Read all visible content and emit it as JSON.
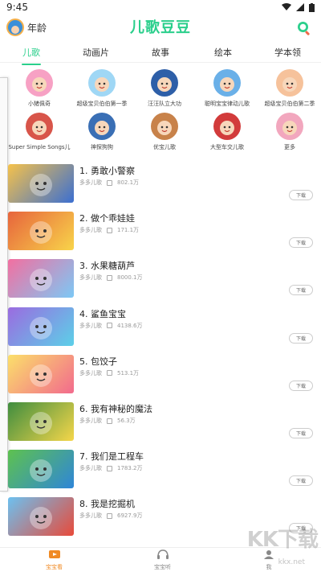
{
  "status_bar": {
    "time": "9:45"
  },
  "header": {
    "age_label": "年龄",
    "brand_title": "儿歌豆豆"
  },
  "tabs": [
    {
      "label": "儿歌",
      "active": true
    },
    {
      "label": "动画片",
      "active": false
    },
    {
      "label": "故事",
      "active": false
    },
    {
      "label": "绘本",
      "active": false
    },
    {
      "label": "学本领",
      "active": false
    }
  ],
  "categories": [
    {
      "label": "小猪佩奇",
      "icon": "peppa-pig-avatar",
      "color": "#f7a1c4"
    },
    {
      "label": "超级宝贝伯伯第一季",
      "icon": "baby-avatar",
      "color": "#9fd7f5"
    },
    {
      "label": "汪汪队立大功",
      "icon": "paw-patrol-avatar",
      "color": "#2e5fa8"
    },
    {
      "label": "聪明宝宝律动儿歌",
      "icon": "baby-boy-avatar",
      "color": "#6ab0e8"
    },
    {
      "label": "超级宝贝伯伯第二季",
      "icon": "baby-girl-avatar",
      "color": "#f6c29b"
    },
    {
      "label": "Super Simple Songs儿",
      "icon": "kid-red-shirt-avatar",
      "color": "#d8554a"
    },
    {
      "label": "神探狗狗",
      "icon": "detective-avatar",
      "color": "#3a6fb5"
    },
    {
      "label": "优宝儿歌",
      "icon": "cat-avatar",
      "color": "#c8824a"
    },
    {
      "label": "大型车交儿歌",
      "icon": "bus-avatar",
      "color": "#d23b3b"
    },
    {
      "label": "更多",
      "icon": "more-avatar",
      "color": "#f2a7be"
    }
  ],
  "songs": [
    {
      "title": "1. 勇敢小警察",
      "artist": "多多儿歌",
      "plays": "802.1万",
      "download_label": "下载",
      "thumb_color": "#f6c24a",
      "thumb_accent": "#3b6fd1"
    },
    {
      "title": "2. 做个乖娃娃",
      "artist": "多多儿歌",
      "plays": "171.1万",
      "download_label": "下载",
      "thumb_color": "#e7643c",
      "thumb_accent": "#f8d44a"
    },
    {
      "title": "3. 水果糖葫芦",
      "artist": "多多儿歌",
      "plays": "8000.1万",
      "download_label": "下载",
      "thumb_color": "#f36fa0",
      "thumb_accent": "#7cc8f5"
    },
    {
      "title": "4. 鲨鱼宝宝",
      "artist": "多多儿歌",
      "plays": "4138.6万",
      "download_label": "下载",
      "thumb_color": "#9b6be0",
      "thumb_accent": "#5cd0e8"
    },
    {
      "title": "5. 包饺子",
      "artist": "多多儿歌",
      "plays": "513.1万",
      "download_label": "下载",
      "thumb_color": "#fbe06a",
      "thumb_accent": "#f26a8d"
    },
    {
      "title": "6. 我有神秘的魔法",
      "artist": "多多儿歌",
      "plays": "56.3万",
      "download_label": "下载",
      "thumb_color": "#3f8d3f",
      "thumb_accent": "#f5d64a"
    },
    {
      "title": "7. 我们是工程车",
      "artist": "多多儿歌",
      "plays": "1783.2万",
      "download_label": "下载",
      "thumb_color": "#5ec24e",
      "thumb_accent": "#2f86d8"
    },
    {
      "title": "8. 我是挖掘机",
      "artist": "多多儿歌",
      "plays": "6927.9万",
      "download_label": "下载",
      "thumb_color": "#6cc1f0",
      "thumb_accent": "#e84a3a"
    }
  ],
  "bottom_nav": [
    {
      "label": "宝宝看",
      "icon": "tv-icon",
      "active": true
    },
    {
      "label": "宝宝听",
      "icon": "headphones-icon",
      "active": false
    },
    {
      "label": "我",
      "icon": "profile-icon",
      "active": false
    }
  ],
  "watermark": {
    "text": "KK下载",
    "sub": "kkx.net"
  },
  "colors": {
    "accent": "#2bcf8c",
    "nav_active": "#f08a24"
  }
}
